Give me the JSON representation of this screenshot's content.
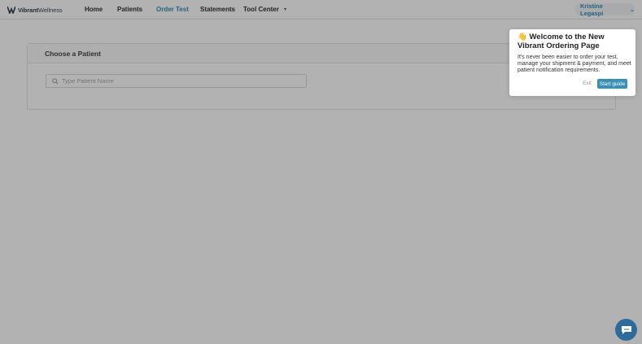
{
  "brand": {
    "logo_text_bold": "Vibrant",
    "logo_text": "Wellness"
  },
  "nav": {
    "items": [
      {
        "label": "Home"
      },
      {
        "label": "Patients"
      },
      {
        "label": "Order Test",
        "active": true
      },
      {
        "label": "Statements"
      },
      {
        "label": "Tool Center"
      }
    ],
    "user_name": "Kristine Legaspi"
  },
  "patient_card": {
    "title": "Choose a Patient",
    "search_placeholder": "Type Patient Name",
    "search_value": ""
  },
  "popover": {
    "emoji": "👋",
    "title": "Welcome to the New Vibrant Ordering Page",
    "body": "It's never been easier to order your test, manage your shipment & payment, and meet patient notification requirements.",
    "exit_label": "Exit",
    "start_label": "Start guide"
  },
  "colors": {
    "accent": "#3a8fb7",
    "chat": "#2d6b9c"
  },
  "icons": {
    "search": "search-icon",
    "chat": "chat-icon",
    "dropdown": "chevron-down-icon"
  }
}
